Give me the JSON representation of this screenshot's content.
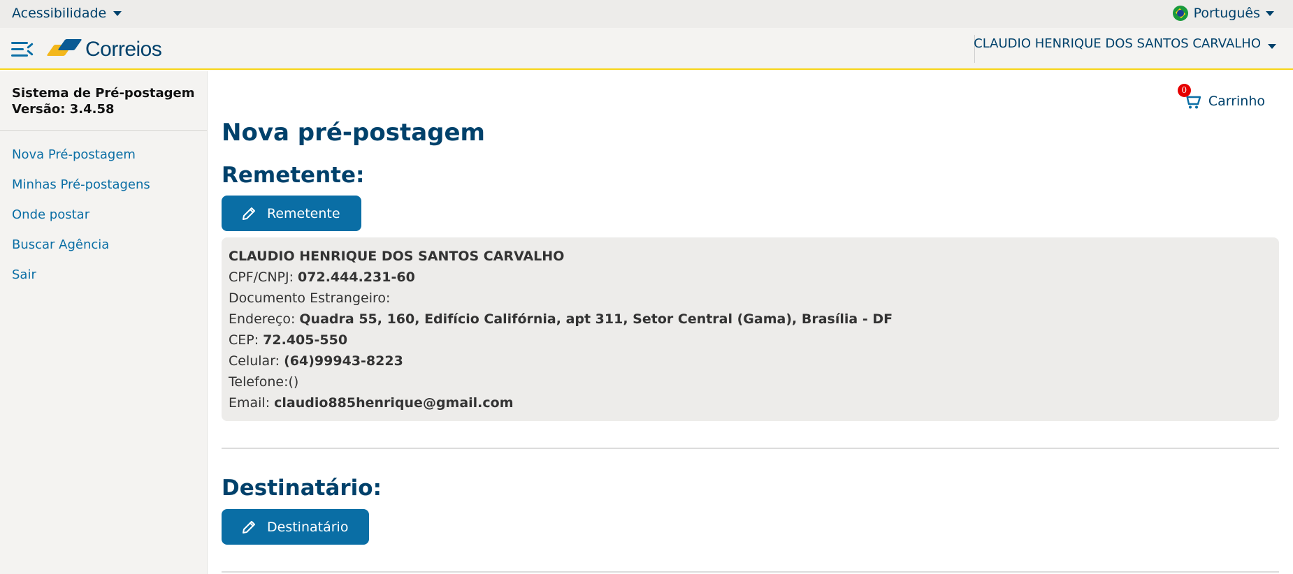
{
  "topbar": {
    "accessibility_label": "Acessibilidade",
    "language_label": "Português"
  },
  "header": {
    "brand": "Correios",
    "user_name": "CLAUDIO HENRIQUE DOS SANTOS CARVALHO"
  },
  "sidebar": {
    "system_title": "Sistema de Pré-postagem",
    "version": "Versão: 3.4.58",
    "items": [
      {
        "label": "Nova Pré-postagem"
      },
      {
        "label": "Minhas Pré-postagens"
      },
      {
        "label": "Onde postar"
      },
      {
        "label": "Buscar Agência"
      },
      {
        "label": "Sair"
      }
    ]
  },
  "cart": {
    "label": "Carrinho",
    "count": "0"
  },
  "main": {
    "page_title": "Nova pré-postagem",
    "sender_heading": "Remetente:",
    "sender_button": "Remetente",
    "recipient_heading": "Destinatário:",
    "recipient_button": "Destinatário"
  },
  "sender": {
    "name": "CLAUDIO HENRIQUE DOS SANTOS CARVALHO",
    "cpf_label": "CPF/CNPJ: ",
    "cpf": "072.444.231-60",
    "foreign_doc_label": "Documento Estrangeiro:",
    "address_label": "Endereço: ",
    "address": "Quadra 55, 160, Edifício Califórnia, apt 311, Setor Central (Gama), Brasília - DF",
    "cep_label": "CEP: ",
    "cep": "72.405-550",
    "mobile_label": "Celular: ",
    "mobile": "(64)99943-8223",
    "phone_label": "Telefone:()",
    "email_label": "Email: ",
    "email": "claudio885henrique@gmail.com"
  },
  "colors": {
    "primary": "#0a6ea5",
    "heading": "#00416b",
    "accent_yellow": "#f7d417",
    "badge": "#e60000"
  }
}
